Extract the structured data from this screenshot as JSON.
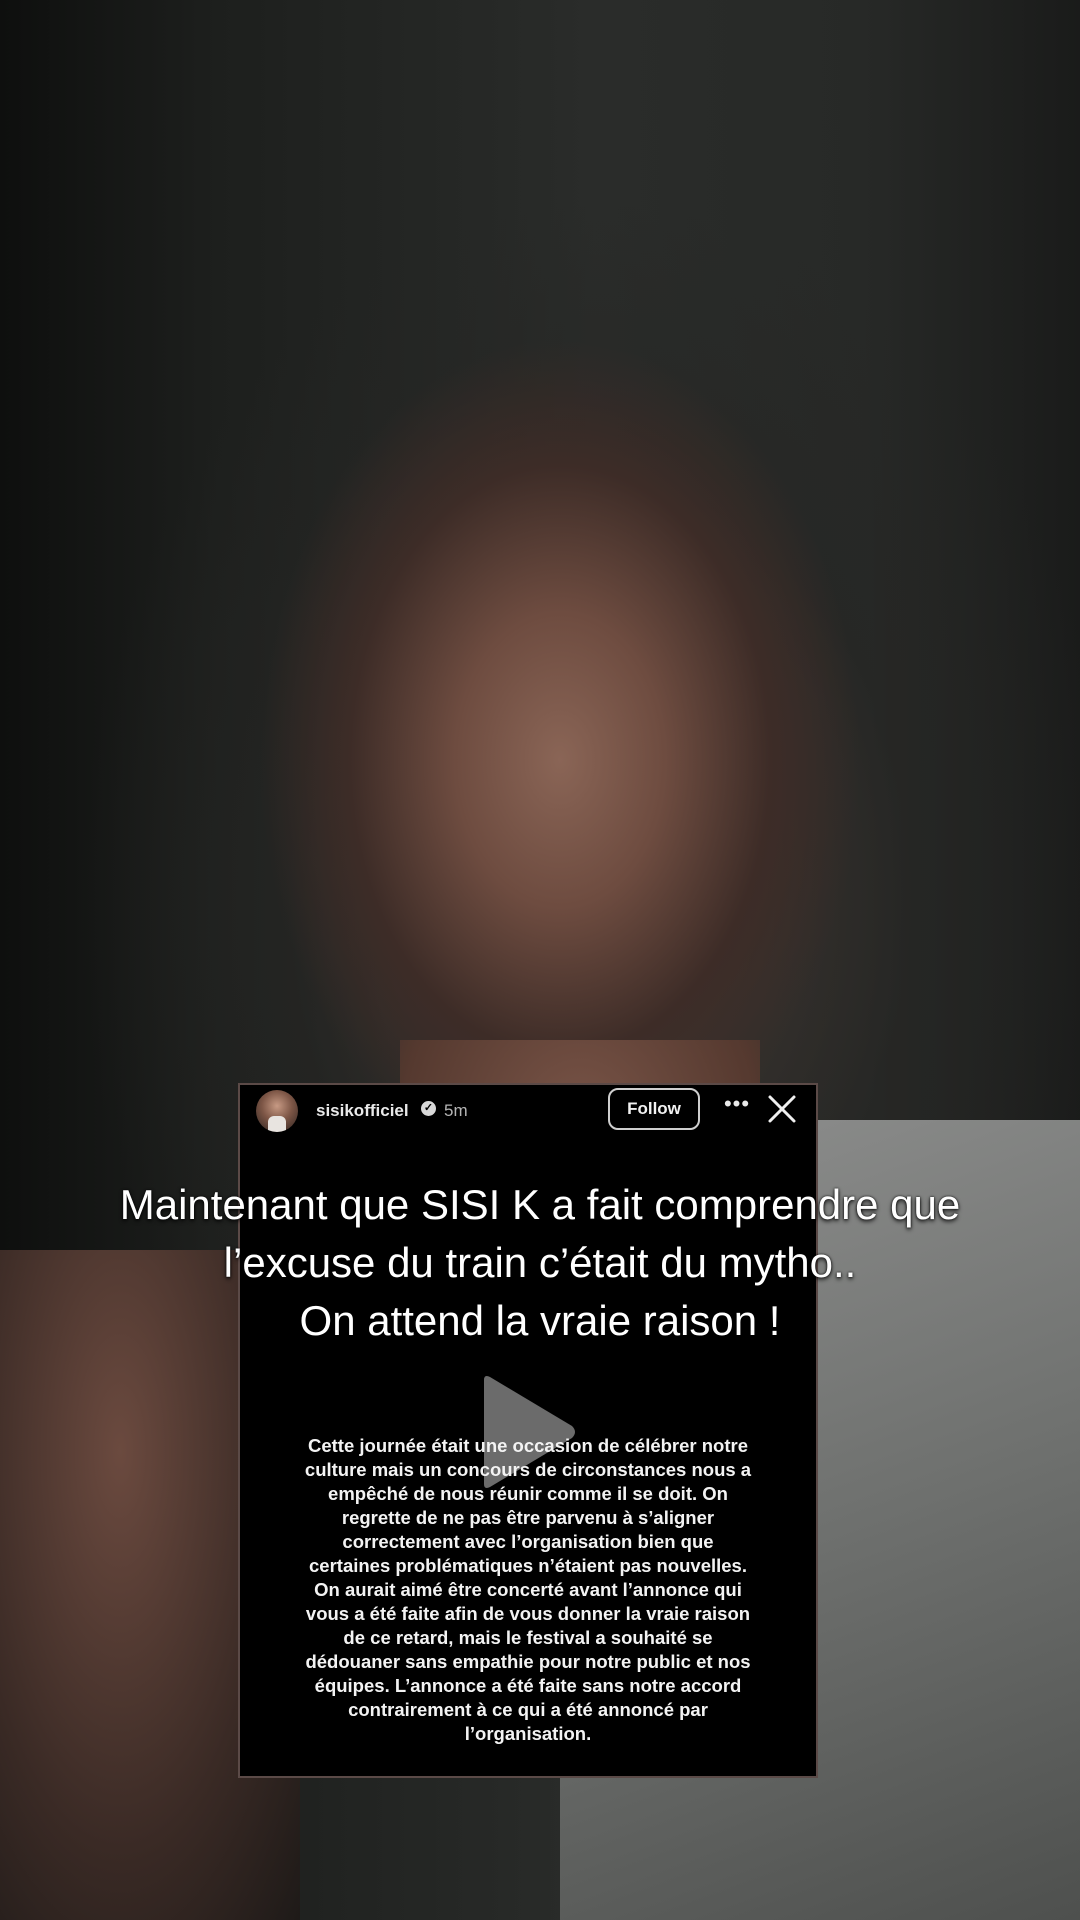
{
  "story": {
    "username": "sisikofficiel",
    "verified_icon": "verified-badge-icon",
    "time_ago": "5m",
    "follow_label": "Follow",
    "more_icon": "more-options-icon",
    "close_icon": "close-icon",
    "statement": "Cette journée était une occasion de célébrer notre\nculture mais un concours de circonstances nous a\nempêché de nous réunir comme il se doit. On\nregrette de ne pas être parvenu à s’aligner\ncorrectement avec l’organisation bien que\ncertaines problématiques n’étaient pas nouvelles.\nOn aurait aimé être concerté avant l’annonce qui\nvous a été faite afin de vous donner la vraie raison\nde ce retard, mais le festival a souhaité se\ndédouaner sans empathie pour notre public et nos\néquipes. L’annonce a été faite sans notre accord\ncontrairement à ce qui a été annoncé par\nl’organisation."
  },
  "caption": {
    "line1": "Maintenant que SISI K a fait comprendre que",
    "line2": "l’excuse du train c’était du mytho..",
    "line3": "On attend la vraie raison !"
  },
  "player": {
    "play_icon": "play-icon"
  },
  "colors": {
    "card_background": "#000000",
    "caption_text": "#ffffff"
  }
}
